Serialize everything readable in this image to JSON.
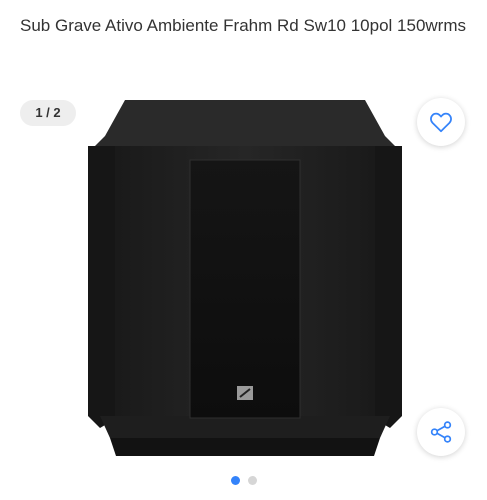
{
  "product": {
    "title": "Sub Grave Ativo Ambiente Frahm Rd Sw10 10pol 150wrms"
  },
  "gallery": {
    "counter": "1 / 2",
    "current_index": 1,
    "total": 2,
    "favorite_icon": "heart-outline-icon",
    "share_icon": "share-icon"
  },
  "colors": {
    "accent": "#3483fa",
    "dot_inactive": "#d6d6d6",
    "speaker_body": "#1f1f1f"
  }
}
